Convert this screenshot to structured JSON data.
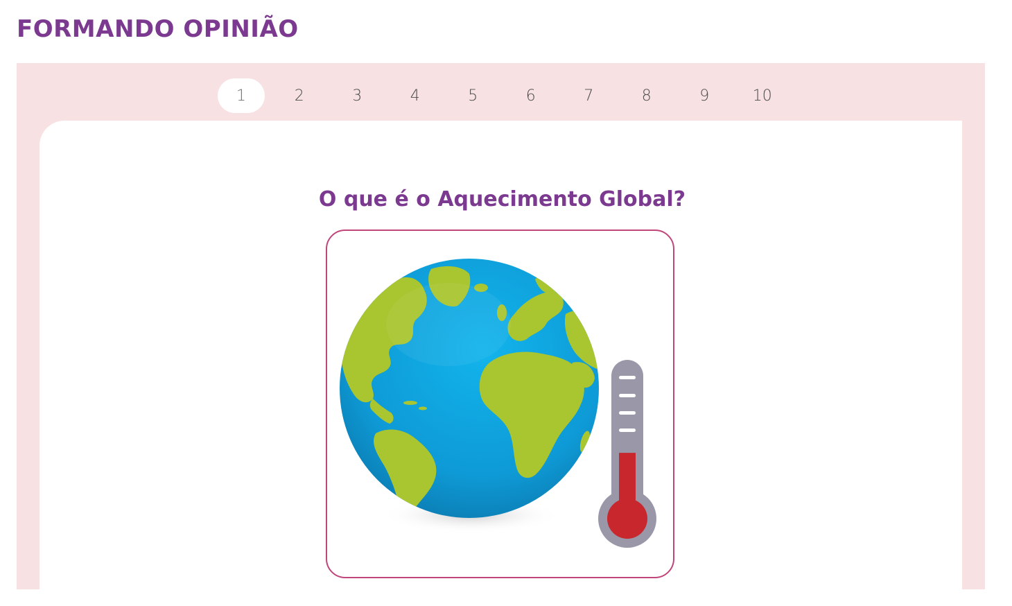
{
  "header": {
    "title": "FORMANDO OPINIÃO"
  },
  "pagination": {
    "active_page": "1",
    "pages": [
      "1",
      "2",
      "3",
      "4",
      "5",
      "6",
      "7",
      "8",
      "9",
      "10"
    ]
  },
  "question": {
    "title": "O que é o Aquecimento Global?",
    "illustration": {
      "icons": [
        "globe-icon",
        "thermometer-icon"
      ],
      "thermometer_level": 0.45
    }
  },
  "colors": {
    "title": "#7b3a8f",
    "panel_background": "#f7e1e3",
    "frame_border": "#c0457a",
    "ocean": "#1aa0dc",
    "land": "#a9c52f",
    "mercury": "#c8282d",
    "thermometer_body": "#9a97a8"
  }
}
